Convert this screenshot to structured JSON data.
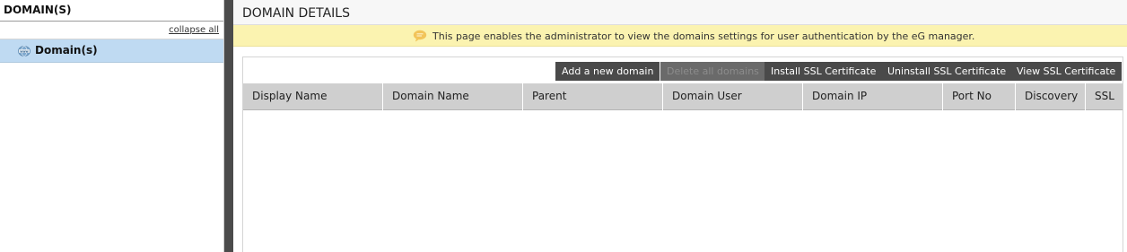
{
  "left_panel": {
    "title": "DOMAIN(S)",
    "collapse_label": "collapse all",
    "tree": [
      {
        "label": "Domain(s)",
        "icon": "www-globe-icon"
      }
    ]
  },
  "main": {
    "title": "DOMAIN DETAILS",
    "info_message": "This page enables the administrator to view the domains settings for user authentication by the eG manager.",
    "toolbar": {
      "add_label": "Add a new domain",
      "delete_all_label": "Delete all domains",
      "install_ssl_label": "Install SSL Certificate",
      "uninstall_ssl_label": "Uninstall SSL Certificate",
      "view_ssl_label": "View SSL Certificate"
    },
    "table": {
      "columns": [
        "Display Name",
        "Domain Name",
        "Parent",
        "Domain User",
        "Domain IP",
        "Port No",
        "Discovery",
        "SSL"
      ],
      "rows": []
    }
  },
  "colors": {
    "splitter": "#4b4b4b",
    "selected_tree_item": "#bfdaf2",
    "info_bar": "#fbf3b0",
    "button": "#4a4a4a",
    "header_row": "#cfcfcf"
  }
}
